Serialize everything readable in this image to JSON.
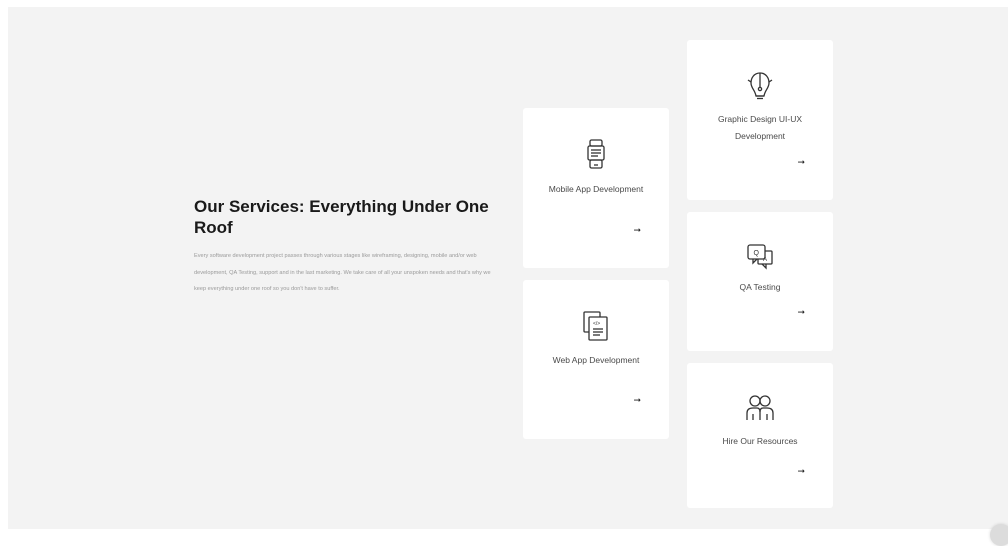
{
  "services_section": {
    "heading": "Our Services: Everything Under One Roof",
    "description": "Every software development project passes through various stages like wireframing, designing, mobile and/or web development, QA Testing, support and in the last marketing. We take care of all your unspoken needs and that's why we keep everything under one roof so you don't have to suffer.",
    "cards": {
      "mobile_app": {
        "title": "Mobile App Development",
        "icon": "mobile-app-icon",
        "arrow": "➞"
      },
      "web_app": {
        "title": "Web App Development",
        "icon": "web-app-icon",
        "arrow": "➞"
      },
      "graphic_design": {
        "title": "Graphic Design UI-UX Development",
        "icon": "graphic-design-icon",
        "arrow": "➞"
      },
      "qa_testing": {
        "title": "QA Testing",
        "icon": "qa-testing-icon",
        "arrow": "➞"
      },
      "hire_resources": {
        "title": "Hire Our Resources",
        "icon": "hire-resources-icon",
        "arrow": "➞"
      }
    }
  }
}
